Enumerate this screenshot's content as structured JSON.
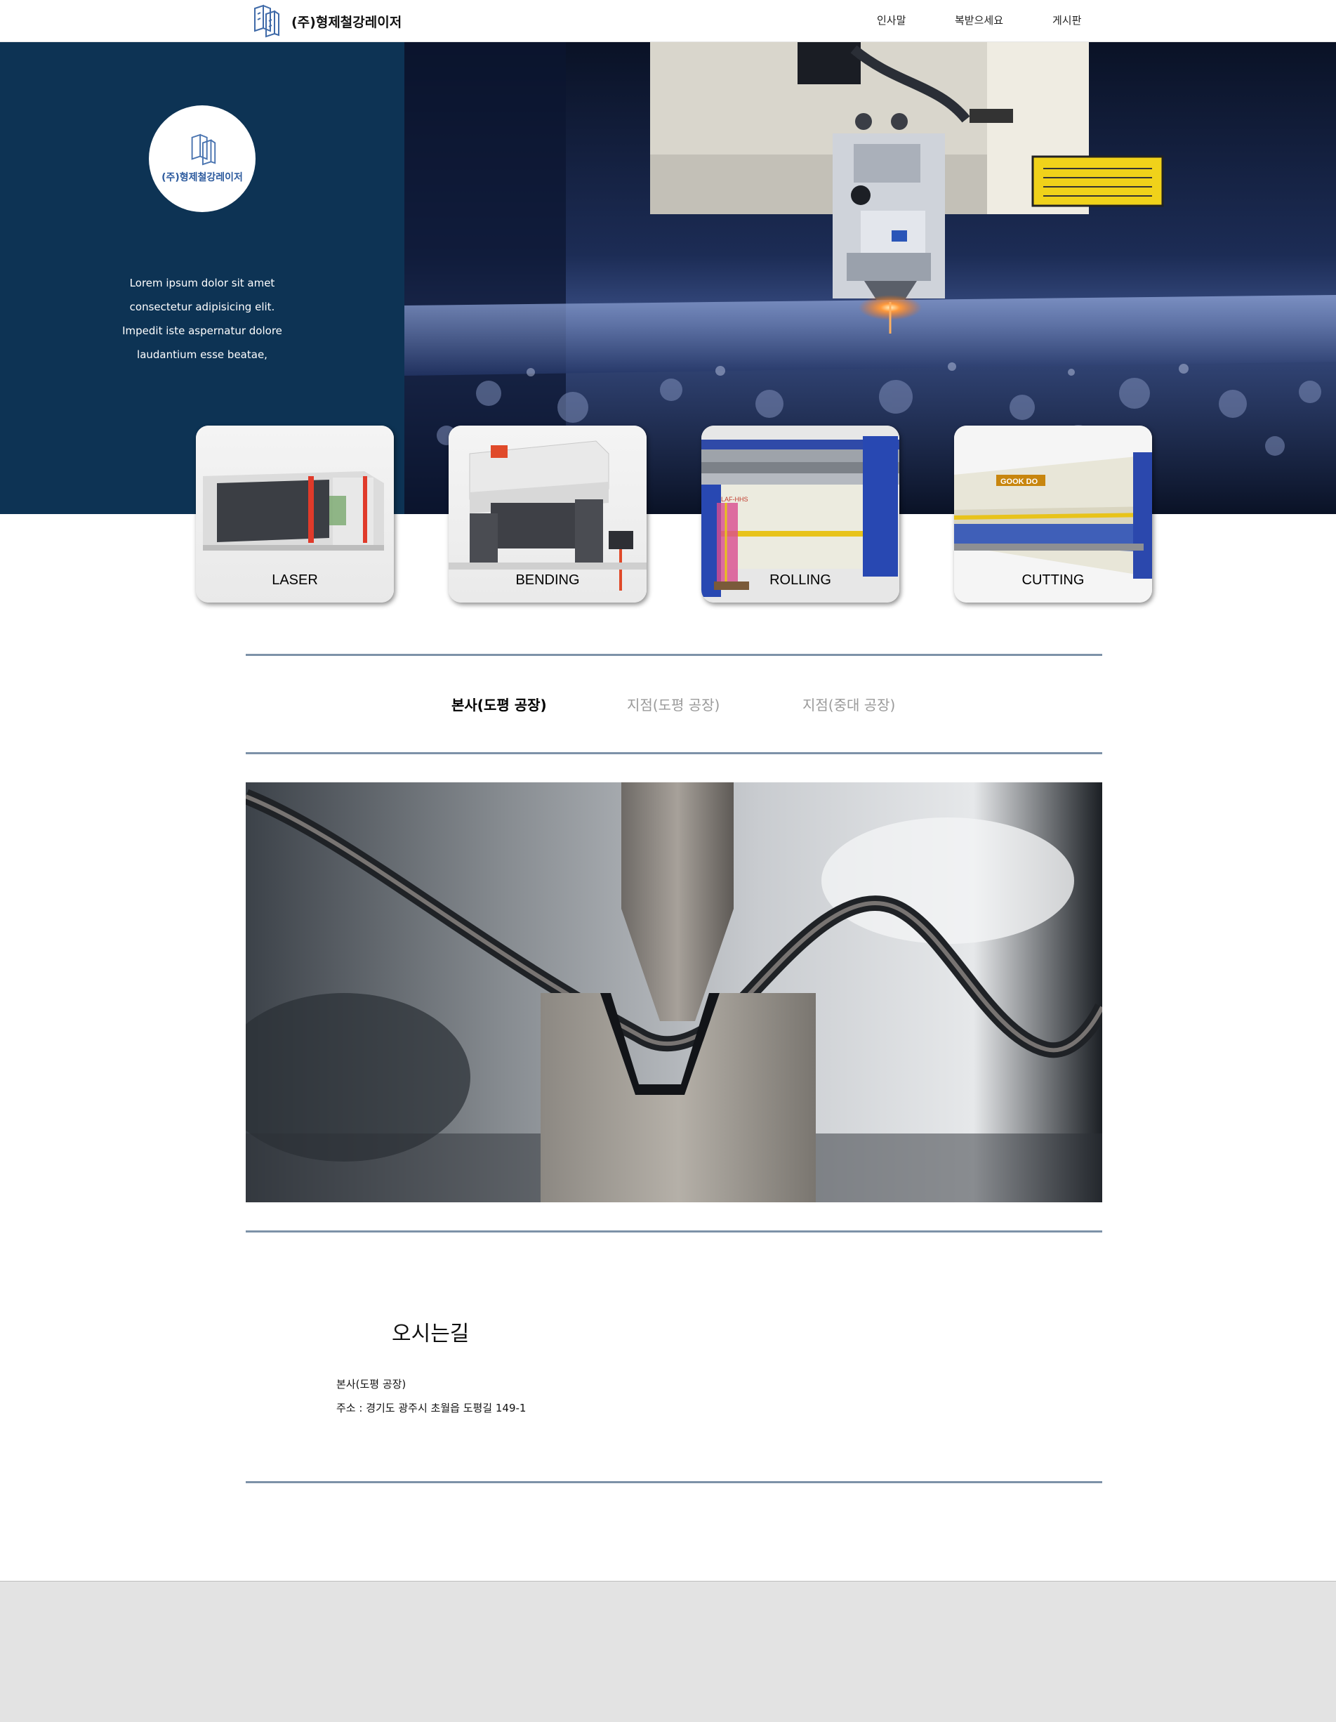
{
  "header": {
    "brand_name": "(주)형제철강레이저",
    "nav": [
      {
        "label": "인사말"
      },
      {
        "label": "복받으세요"
      },
      {
        "label": "게시판"
      }
    ]
  },
  "hero": {
    "circle_name": "(주)형제철강레이저",
    "text_lines": [
      "Lorem ipsum dolor sit amet",
      "consectetur adipisicing elit.",
      "Impedit iste aspernatur dolore",
      "laudantium esse beatae,"
    ],
    "colors": {
      "panel": "#0d3354",
      "accent": "#2d5b9e"
    }
  },
  "products": [
    {
      "label": "LASER"
    },
    {
      "label": "BENDING"
    },
    {
      "label": "ROLLING"
    },
    {
      "label": "CUTTING"
    }
  ],
  "tabs": [
    {
      "label": "본사(도평 공장)",
      "active": true
    },
    {
      "label": "지점(도평 공장)",
      "active": false
    },
    {
      "label": "지점(중대 공장)",
      "active": false
    }
  ],
  "directions": {
    "title": "오시는길",
    "location": "본사(도평 공장)",
    "address": "주소 : 경기도 광주시 초월읍 도평길 149-1"
  }
}
